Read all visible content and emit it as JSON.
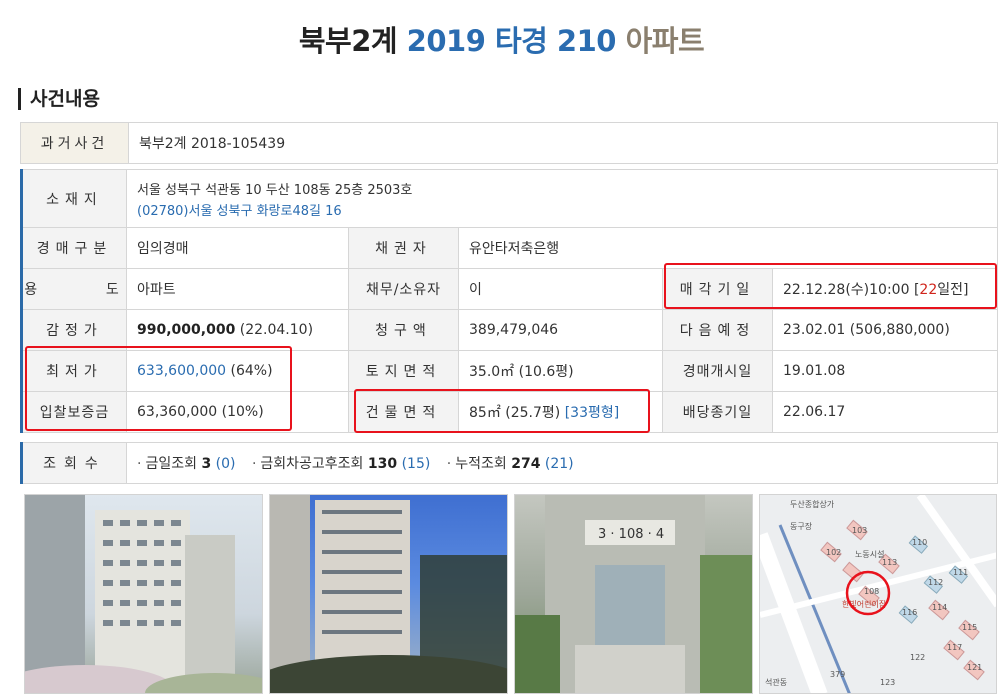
{
  "title": {
    "court": "북부2계",
    "case": "2019 타경 210",
    "kind": "아파트"
  },
  "section": "사건내용",
  "past_case": {
    "label": "과거사건",
    "value": "북부2계 2018-105439"
  },
  "location": {
    "label": "소재지",
    "address": "서울 성북구 석관동 10 두산 108동 25층 2503호",
    "road_address": "(02780)서울 성북구  화랑로48길  16"
  },
  "rows": {
    "auction_type": {
      "label": "경매구분",
      "value": "임의경매"
    },
    "creditor": {
      "label": "채권자",
      "value": "유안타저축은행"
    },
    "usage": {
      "label": "용      도",
      "value": "아파트"
    },
    "debtor": {
      "label": "채무/소유자",
      "value": "이"
    },
    "sale_date": {
      "label": "매각기일",
      "value": "22.12.28(수)10:00 [",
      "days": "22",
      "suffix": "일전]"
    },
    "appraisal": {
      "label": "감정가",
      "amount": "990,000,000",
      "note": " (22.04.10)"
    },
    "claim": {
      "label": "청구액",
      "value": "389,479,046"
    },
    "next": {
      "label": "다음예정",
      "value": "23.02.01 (506,880,000)"
    },
    "min_price": {
      "label": "최저가",
      "amount": "633,600,000",
      "note": " (64%)"
    },
    "land_area": {
      "label": "토지면적",
      "value": "35.0㎡ (10.6평)"
    },
    "start_date": {
      "label": "경매개시일",
      "value": "19.01.08"
    },
    "deposit": {
      "label": "입찰보증금",
      "value": "63,360,000 (10%)"
    },
    "building_area": {
      "label": "건물면적",
      "value": "85㎡ (25.7평) ",
      "type": "[33평형]"
    },
    "dividend_end": {
      "label": "배당종기일",
      "value": "22.06.17"
    }
  },
  "views": {
    "label": "조회수",
    "items": [
      {
        "name": "금일조회 ",
        "count": "3",
        "sub": "(0)"
      },
      {
        "name": "금회차공고후조회 ",
        "count": "130",
        "sub": "(15)"
      },
      {
        "name": "누적조회 ",
        "count": "274",
        "sub": "(21)"
      }
    ]
  },
  "map": {
    "labels": [
      "두산종합상가",
      "동구장",
      "노동시설",
      "한빛어린이집",
      "석관동",
      "379",
      "102",
      "103",
      "108",
      "110",
      "111",
      "112",
      "113",
      "114",
      "115",
      "116",
      "117",
      "121",
      "122",
      "123"
    ]
  }
}
